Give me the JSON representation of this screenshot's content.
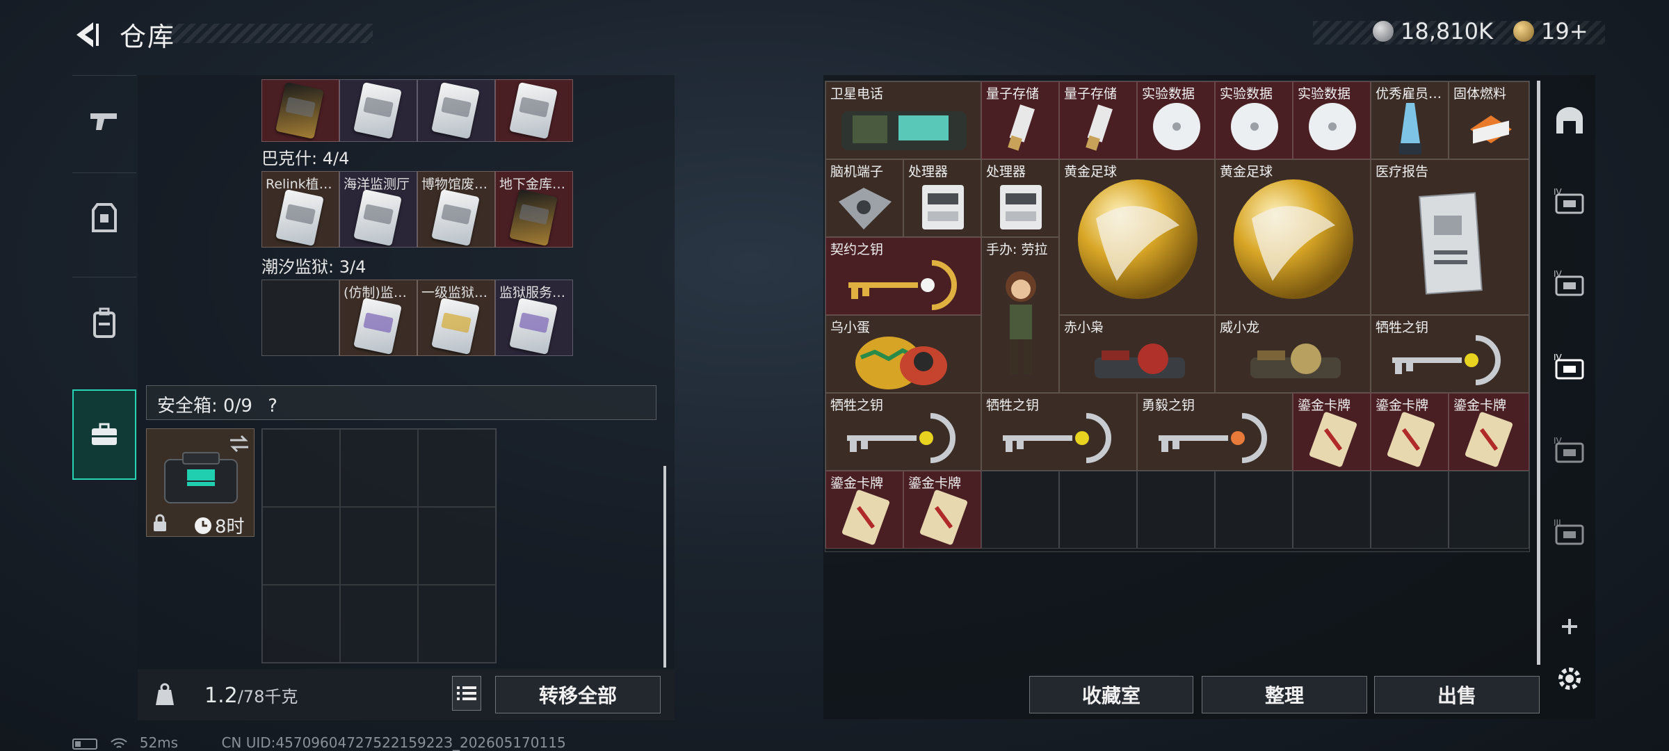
{
  "header": {
    "title": "仓库",
    "currency_amount": "18,810K",
    "tickets": "19+"
  },
  "colors": {
    "accent_teal": "#27d4b4",
    "slot_red": "#4a1f24",
    "slot_brown": "#3b2d26",
    "slot_purple": "#2a2638"
  },
  "left_nav": {
    "items": [
      "weapon-icon",
      "armor-icon",
      "backpack-icon",
      "safebox-icon"
    ],
    "active": 3
  },
  "keycard_groups": [
    {
      "title": "",
      "slots": [
        "",
        "",
        "",
        ""
      ]
    },
    {
      "title": "巴克什: 4/4",
      "slots": [
        "Relink植…",
        "海洋监测厅",
        "博物馆废…",
        "地下金库…"
      ]
    },
    {
      "title": "潮汐监狱: 3/4",
      "slots": [
        "",
        "(仿制)监…",
        "一级监狱…",
        "监狱服务…"
      ]
    }
  ],
  "safe_box": {
    "label": "安全箱: 0/9",
    "help": "?",
    "timer": "8时"
  },
  "footer": {
    "weight_current": "1.2",
    "weight_max": "/78千克",
    "transfer_all": "转移全部"
  },
  "stash_items": [
    {
      "label": "卫星电话",
      "kind": "phone"
    },
    {
      "label": "量子存储",
      "kind": "usb"
    },
    {
      "label": "量子存储",
      "kind": "usb"
    },
    {
      "label": "实验数据",
      "kind": "disc"
    },
    {
      "label": "实验数据",
      "kind": "disc"
    },
    {
      "label": "实验数据",
      "kind": "disc"
    },
    {
      "label": "优秀雇员…",
      "kind": "trophy"
    },
    {
      "label": "固体燃料",
      "kind": "fuel"
    },
    {
      "label": "脑机端子",
      "kind": "device"
    },
    {
      "label": "处理器",
      "kind": "cpu"
    },
    {
      "label": "处理器",
      "kind": "cpu"
    },
    {
      "label": "黄金足球",
      "kind": "ball"
    },
    {
      "label": "黄金足球",
      "kind": "ball"
    },
    {
      "label": "医疗报告",
      "kind": "report"
    },
    {
      "label": "契约之钥",
      "kind": "key-gold"
    },
    {
      "label": "手办: 劳拉",
      "kind": "figure"
    },
    {
      "label": "乌小蛋",
      "kind": "egg"
    },
    {
      "label": "赤小枭",
      "kind": "mech"
    },
    {
      "label": "威小龙",
      "kind": "mech"
    },
    {
      "label": "牺牲之钥",
      "kind": "key-silver"
    },
    {
      "label": "牺牲之钥",
      "kind": "key-silver"
    },
    {
      "label": "牺牲之钥",
      "kind": "key-silver"
    },
    {
      "label": "勇毅之钥",
      "kind": "key-orange"
    },
    {
      "label": "鎏金卡牌",
      "kind": "goldcard"
    },
    {
      "label": "鎏金卡牌",
      "kind": "goldcard"
    },
    {
      "label": "鎏金卡牌",
      "kind": "goldcard"
    },
    {
      "label": "鎏金卡牌",
      "kind": "goldcard"
    },
    {
      "label": "鎏金卡牌",
      "kind": "goldcard"
    }
  ],
  "actions": {
    "collection": "收藏室",
    "sort": "整理",
    "sell": "出售"
  },
  "right_side_icons": [
    "arch-icon",
    "tier4-case-icon",
    "tier4-case-icon",
    "tier4-case-selected-icon",
    "tier4-case-icon",
    "tier3-case-icon",
    "plus-icon",
    "settings-icon"
  ],
  "status_bar": {
    "ping": "52ms",
    "uid": "CN UID:4570960472752215922З_202605170115"
  }
}
